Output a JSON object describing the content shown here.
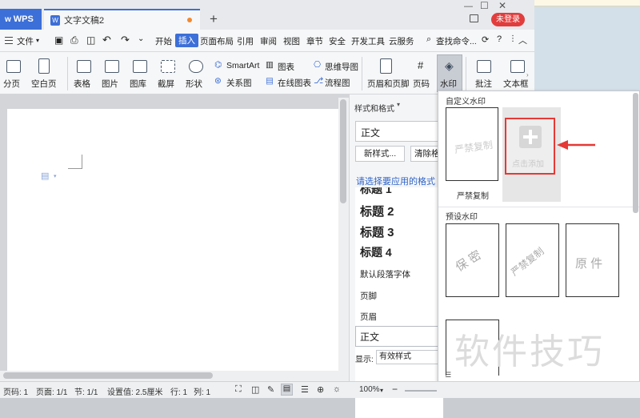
{
  "app": {
    "logo_label": "WPS",
    "tab_title": "文字文稿2",
    "new_tab": "+",
    "login_label": "未登录"
  },
  "menu": {
    "file_label": "文件",
    "tabs": [
      "开始",
      "插入",
      "页面布局",
      "引用",
      "审阅",
      "视图",
      "章节",
      "安全",
      "开发工具",
      "云服务"
    ],
    "search_label": "查找命令..."
  },
  "toolbar": {
    "items": {
      "fenye": "分页",
      "kongbaiye": "空白页",
      "biaoge": "表格",
      "tupian": "图片",
      "tuku": "图库",
      "jieping": "截屏",
      "xingzhuang": "形状",
      "smartart": "SmartArt",
      "tubiao": "图表",
      "guanxitu": "关系图",
      "zaixiantubiao": "在线图表",
      "siweidaotu": "思维导图",
      "liuchengtu": "流程图",
      "yemeiyejiao": "页眉和页脚",
      "yema": "页码",
      "shuiyin": "水印",
      "pizhu": "批注",
      "wenbenkuang": "文本框"
    }
  },
  "styles_pane": {
    "title": "样式和格式",
    "current_style": "正文",
    "new_style_button": "新样式...",
    "clear_button": "清除格",
    "hint": "请选择要应用的格式",
    "partial_item": "标题 1",
    "items": [
      "标题 2",
      "标题 3",
      "标题 4",
      "默认段落字体",
      "页脚",
      "页眉",
      "正文"
    ],
    "show_label": "显示:",
    "show_value": "有效样式"
  },
  "watermark_panel": {
    "custom_section": "自定义水印",
    "custom_card_text": "严禁复制",
    "custom_card_caption": "严禁复制",
    "add_card_text": "点击添加",
    "preset_section": "预设水印",
    "presets": [
      "保 密",
      "严禁复制",
      "原 件"
    ]
  },
  "overlay_watermark": "软件技巧",
  "statusbar": {
    "page_num": "页码: 1",
    "page_total": "页面: 1/1",
    "section": "节: 1/1",
    "setting": "设置值: 2.5厘米",
    "row": "行: 1",
    "col": "列: 1",
    "zoom": "100%"
  },
  "colors": {
    "accent": "#3c6fd8",
    "login": "#e23d3d",
    "highlight": "#e53935",
    "style_hint": "#2f64c8"
  }
}
